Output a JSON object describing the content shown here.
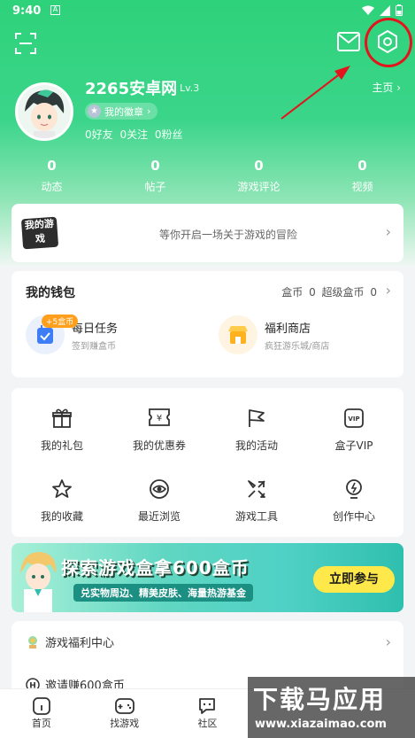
{
  "status_bar": {
    "time": "9:40",
    "notif": "A"
  },
  "profile": {
    "username": "2265安卓网",
    "level": "Lv.3",
    "badge_label": "我的徽章",
    "follow_text": "0好友 0关注 0粉丝",
    "home_link": "主页"
  },
  "stats": [
    {
      "value": "0",
      "label": "动态"
    },
    {
      "value": "0",
      "label": "帖子"
    },
    {
      "value": "0",
      "label": "游戏评论"
    },
    {
      "value": "0",
      "label": "视频"
    }
  ],
  "adventure": {
    "logo": "我的游戏",
    "text": "等你开启一场关于游戏的冒险"
  },
  "wallet": {
    "title": "我的钱包",
    "coins": "盒币 0   超级盒币 0",
    "task_tag": "+5盒币",
    "daily_task": {
      "title": "每日任务",
      "sub": "签到赚盒币"
    },
    "shop": {
      "title": "福利商店",
      "sub": "疯狂游乐城/商店"
    }
  },
  "grid": [
    {
      "label": "我的礼包",
      "icon": "gift-icon"
    },
    {
      "label": "我的优惠券",
      "icon": "coupon-icon"
    },
    {
      "label": "我的活动",
      "icon": "flag-icon"
    },
    {
      "label": "盒子VIP",
      "icon": "vip-icon"
    },
    {
      "label": "我的收藏",
      "icon": "star-icon"
    },
    {
      "label": "最近浏览",
      "icon": "eye-icon"
    },
    {
      "label": "游戏工具",
      "icon": "tools-icon"
    },
    {
      "label": "创作中心",
      "icon": "bulb-icon"
    }
  ],
  "banner": {
    "title": "探索游戏盒拿600盒币",
    "subtitle": "兑实物周边、精美皮肤、海量热游基金",
    "button": "立即参与"
  },
  "list": [
    {
      "label": "游戏福利中心"
    },
    {
      "label": "邀请赚600盒币"
    }
  ],
  "tabs": [
    {
      "label": "首页"
    },
    {
      "label": "找游戏"
    },
    {
      "label": "社区"
    },
    {
      "label": ""
    },
    {
      "label": ""
    }
  ],
  "watermark": {
    "line1": "下载马应用",
    "line2": "www.xiazaimao.com"
  },
  "colors": {
    "accent": "#2ed27a",
    "annotation": "#e3141c",
    "banner_button": "#ffe94a"
  }
}
